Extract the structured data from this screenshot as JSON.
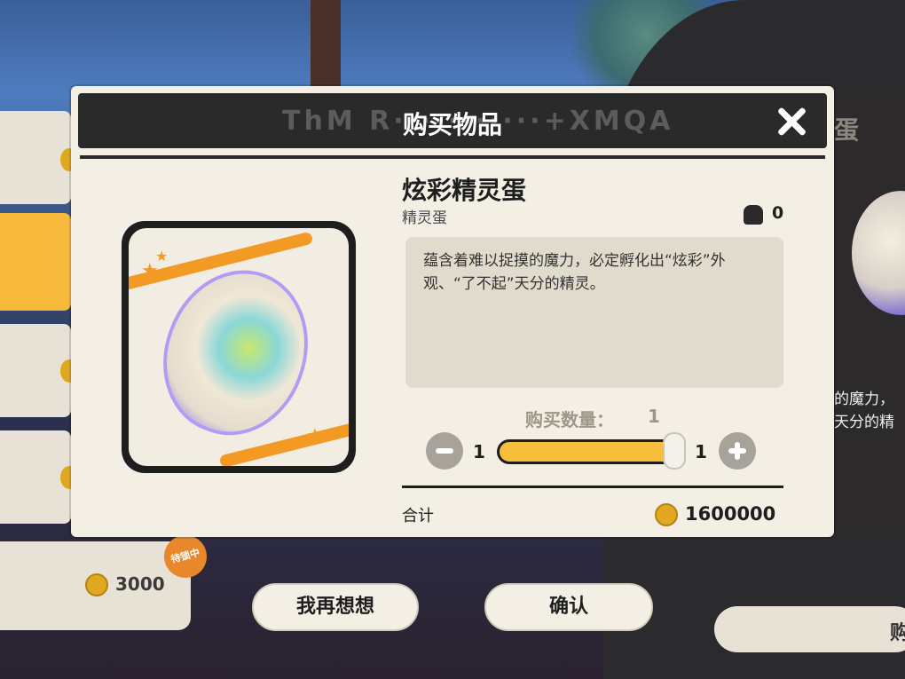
{
  "dialog": {
    "title": "购买物品",
    "item_name": "炫彩精灵蛋",
    "item_type": "精灵蛋",
    "owned_count": "0",
    "description": "蕴含着难以捉摸的魔力，必定孵化出“炫彩”外观、“了不起”天分的精灵。",
    "quantity_label": "购买数量：",
    "quantity_value": "1",
    "slider_min": "1",
    "slider_max": "1",
    "total_label": "合计",
    "total_value": "1600000"
  },
  "buttons": {
    "cancel_label": "我再想想",
    "confirm_label": "确认"
  },
  "background": {
    "left_card_price": "3000",
    "left_card_badge": "待锁中",
    "right_title": "蛋",
    "right_desc_line1": "的魔力，",
    "right_desc_line2": "天分的精",
    "right_button": "购"
  },
  "colors": {
    "accent_yellow": "#f6be3a",
    "header_dark": "#2a2a2a",
    "panel_bg": "#f3efe4",
    "orange": "#f29a24"
  },
  "icons": [
    "close-icon",
    "backpack-icon",
    "minus-icon",
    "plus-icon",
    "coin-icon",
    "star-icon",
    "rainbow-egg-icon"
  ]
}
